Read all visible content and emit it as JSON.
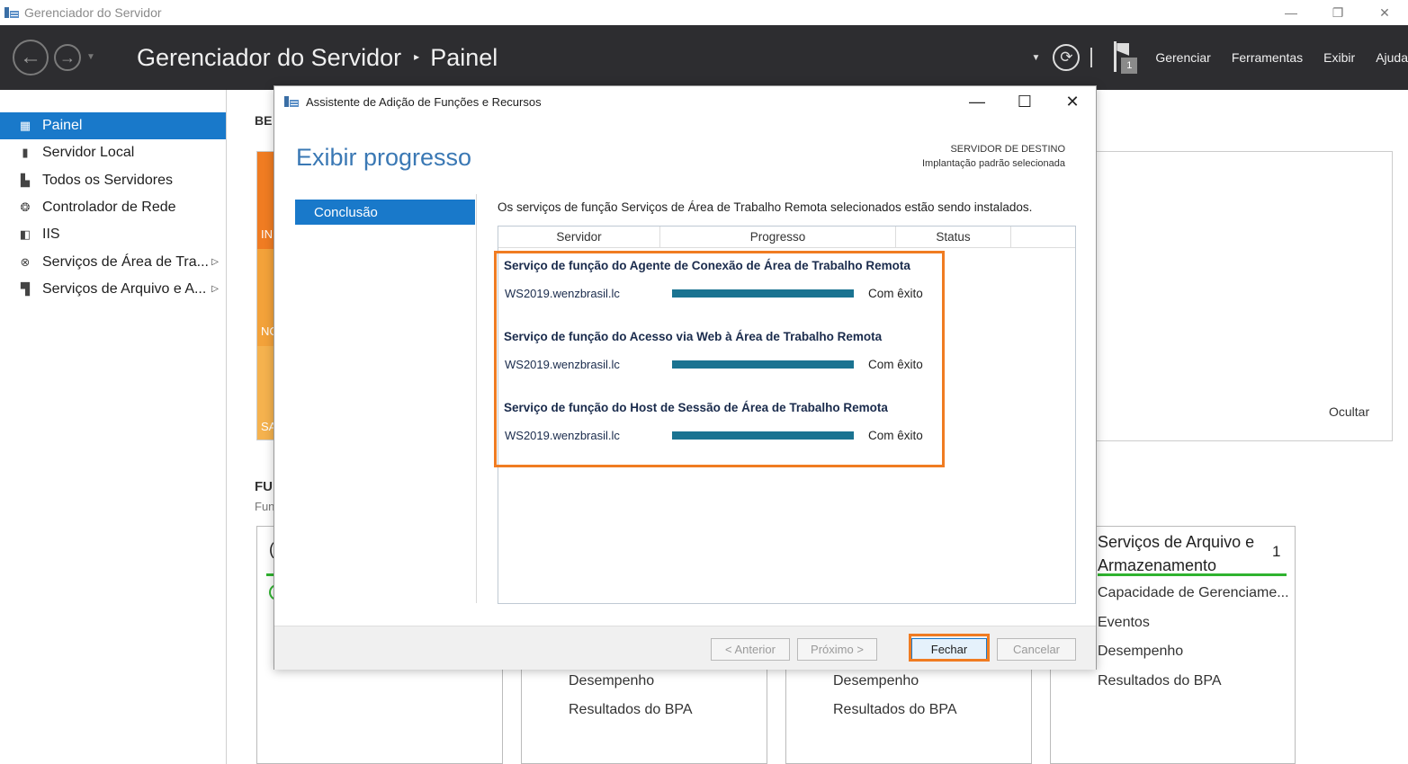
{
  "window": {
    "title": "Gerenciador do Servidor",
    "controls": [
      "—",
      "❐",
      "✕"
    ]
  },
  "header": {
    "breadcrumb_root": "Gerenciador do Servidor",
    "breadcrumb_sep": "▸",
    "breadcrumb_page": "Painel",
    "flag_count": "1",
    "menu": [
      "Gerenciar",
      "Ferramentas",
      "Exibir",
      "Ajuda"
    ]
  },
  "sidebar": {
    "items": [
      {
        "label": "Painel",
        "icon": "dashboard-icon",
        "glyph": "▦",
        "active": true
      },
      {
        "label": "Servidor Local",
        "icon": "server-icon",
        "glyph": "▮",
        "active": false
      },
      {
        "label": "Todos os Servidores",
        "icon": "servers-icon",
        "glyph": "▙",
        "active": false
      },
      {
        "label": "Controlador de Rede",
        "icon": "network-controller-icon",
        "glyph": "❂",
        "active": false
      },
      {
        "label": "IIS",
        "icon": "iis-icon",
        "glyph": "◧",
        "active": false
      },
      {
        "label": "Serviços de Área de Tra...",
        "icon": "remote-desktop-icon",
        "glyph": "⊗",
        "active": false,
        "arrow": "▷"
      },
      {
        "label": "Serviços de Arquivo e A...",
        "icon": "file-services-icon",
        "glyph": "▜",
        "active": false,
        "arrow": "▷"
      }
    ]
  },
  "dashboard": {
    "welcome_label": "BE",
    "strip_labels": [
      "IN",
      "NO",
      "SA"
    ],
    "hide_label": "Ocultar",
    "roles_title": "FU",
    "roles_sub": "Fun",
    "card_partial_label": "(",
    "cards": [
      {
        "lines": [
          "Desempenho",
          "Resultados do BPA"
        ]
      },
      {
        "lines": [
          "Desempenho",
          "Resultados do BPA"
        ]
      }
    ],
    "file_card": {
      "title": "Serviços de Arquivo e Armazenamento",
      "count": "1",
      "lines": [
        "Capacidade de Gerenciame...",
        "Eventos",
        "Desempenho",
        "Resultados do BPA"
      ]
    }
  },
  "dialog": {
    "title": "Assistente de Adição de Funções e Recursos",
    "heading": "Exibir progresso",
    "dest_label": "SERVIDOR DE DESTINO",
    "dest_value": "Implantação padrão selecionada",
    "step": "Conclusão",
    "intro": "Os serviços de função Serviços de Área de Trabalho Remota selecionados estão sendo instalados.",
    "columns": [
      "Servidor",
      "Progresso",
      "Status"
    ],
    "groups": [
      {
        "title": "Serviço de função do Agente de Conexão de Área de Trabalho Remota",
        "server": "WS2019.wenzbrasil.lc",
        "progress": 1.0,
        "status": "Com êxito"
      },
      {
        "title": "Serviço de função do Acesso via Web à Área de Trabalho Remota",
        "server": "WS2019.wenzbrasil.lc",
        "progress": 1.0,
        "status": "Com êxito"
      },
      {
        "title": "Serviço de função do Host de Sessão de Área de Trabalho Remota",
        "server": "WS2019.wenzbrasil.lc",
        "progress": 1.0,
        "status": "Com êxito"
      }
    ],
    "buttons": {
      "previous": "< Anterior",
      "next": "Próximo >",
      "close": "Fechar",
      "cancel": "Cancelar"
    },
    "controls": {
      "minimize": "—",
      "maximize": "☐",
      "close": "✕"
    }
  },
  "colors": {
    "accent": "#1979ca",
    "header_bg": "#2d2d30",
    "highlight": "#f07c22",
    "progress": "#1a7391"
  }
}
